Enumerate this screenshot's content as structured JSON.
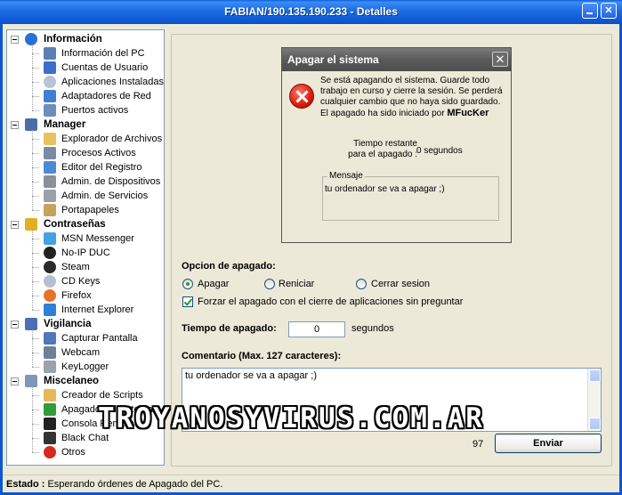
{
  "window": {
    "title": "FABIAN/190.135.190.233 - Detalles",
    "minimize_glyph": "",
    "close_glyph": "✕"
  },
  "tree": {
    "categories": [
      {
        "label": "Información",
        "icon": "info-icon",
        "items": [
          {
            "label": "Información del PC",
            "icon": "computer-icon"
          },
          {
            "label": "Cuentas de Usuario",
            "icon": "user-icon"
          },
          {
            "label": "Aplicaciones Instaladas",
            "icon": "cd-icon"
          },
          {
            "label": "Adaptadores de Red",
            "icon": "network-icon"
          },
          {
            "label": "Puertos activos",
            "icon": "plug-icon"
          }
        ]
      },
      {
        "label": "Manager",
        "icon": "monitor-icon",
        "items": [
          {
            "label": "Explorador de Archivos",
            "icon": "folder-search-icon"
          },
          {
            "label": "Procesos Activos",
            "icon": "process-list-icon"
          },
          {
            "label": "Editor del Registro",
            "icon": "registry-icon"
          },
          {
            "label": "Admin. de Dispositivos",
            "icon": "device-gear-icon"
          },
          {
            "label": "Admin. de Servicios",
            "icon": "service-gear-icon"
          },
          {
            "label": "Portapapeles",
            "icon": "clipboard-icon"
          }
        ]
      },
      {
        "label": "Contraseñas",
        "icon": "key-icon",
        "items": [
          {
            "label": "MSN Messenger",
            "icon": "msn-icon"
          },
          {
            "label": "No-IP DUC",
            "icon": "noip-icon"
          },
          {
            "label": "Steam",
            "icon": "steam-icon"
          },
          {
            "label": "CD Keys",
            "icon": "cd-key-icon"
          },
          {
            "label": "Firefox",
            "icon": "firefox-icon"
          },
          {
            "label": "Internet Explorer",
            "icon": "ie-icon"
          }
        ]
      },
      {
        "label": "Vigilancia",
        "icon": "eye-icon",
        "items": [
          {
            "label": "Capturar Pantalla",
            "icon": "screen-capture-icon"
          },
          {
            "label": "Webcam",
            "icon": "webcam-icon"
          },
          {
            "label": "KeyLogger",
            "icon": "keyboard-icon"
          }
        ]
      },
      {
        "label": "Miscelaneo",
        "icon": "wrench-icon",
        "items": [
          {
            "label": "Creador de Scripts",
            "icon": "script-icon"
          },
          {
            "label": "Apagado del sistema",
            "icon": "windows-icon"
          },
          {
            "label": "Consola Remota",
            "icon": "console-icon"
          },
          {
            "label": "Black Chat",
            "icon": "chat-icon"
          },
          {
            "label": "Otros",
            "icon": "error-icon"
          }
        ]
      }
    ]
  },
  "dialog": {
    "title": "Apagar el sistema",
    "close_glyph": "✕",
    "message": "Se está apagando el sistema. Guarde todo trabajo en curso y cierre la sesión. Se perderá cualquier cambio que no haya sido guardado. El apagado ha sido iniciado por",
    "initiator": "MFucKer",
    "remaining_label_1": "Tiempo restante",
    "remaining_label_2": "para el apagado :",
    "remaining_value": "0 segundos",
    "message_group_label": "Mensaje",
    "message_text": "tu ordenador se va a apagar ;)"
  },
  "options": {
    "heading": "Opcion de apagado:",
    "radios": [
      {
        "label": "Apagar",
        "selected": true
      },
      {
        "label": "Reniciar",
        "selected": false
      },
      {
        "label": "Cerrar sesion",
        "selected": false
      }
    ],
    "force_label": "Forzar el apagado con el cierre de aplicaciones sin preguntar",
    "force_checked": true
  },
  "timer": {
    "label": "Tiempo de apagado:",
    "value": "0",
    "unit": "segundos"
  },
  "comment": {
    "label": "Comentario (Max. 127 caracteres):",
    "value": "tu ordenador se va a apagar ;)",
    "remaining": "97"
  },
  "send_button": "Enviar",
  "watermark": "TROYANOSYVIRUS.COM.AR",
  "status": {
    "label": "Estado :",
    "text": "Esperando órdenes de Apagado del PC."
  },
  "colors": {
    "titlebar": "#0c56d0",
    "panel_bg": "#ece9d8",
    "dialog_title": "#5a5a5a"
  }
}
